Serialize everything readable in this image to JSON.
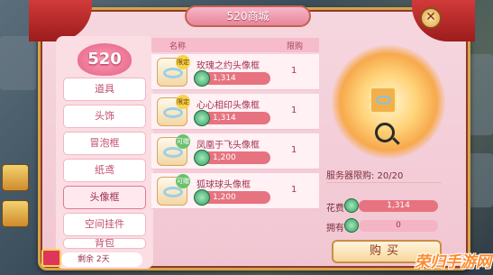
{
  "window": {
    "title": "520商城",
    "close_glyph": "✕"
  },
  "badge": "520",
  "categories": [
    {
      "label": "道具"
    },
    {
      "label": "头饰"
    },
    {
      "label": "冒泡框"
    },
    {
      "label": "纸鸢"
    },
    {
      "label": "头像框",
      "active": true
    },
    {
      "label": "空间挂件"
    },
    {
      "label": "背包"
    }
  ],
  "remaining": "剩余 2天",
  "table": {
    "col_name": "名称",
    "col_limit": "限购",
    "rows": [
      {
        "name": "玫瑰之约头像框",
        "price": "1,314",
        "limit": "1",
        "tag": "限定",
        "tag_color": "gold"
      },
      {
        "name": "心心相印头像框",
        "price": "1,314",
        "limit": "1",
        "tag": "限定",
        "tag_color": "gold"
      },
      {
        "name": "凤凰于飞头像框",
        "price": "1,200",
        "limit": "1",
        "tag": "可赠",
        "tag_color": "green"
      },
      {
        "name": "狐球球头像框",
        "price": "1,200",
        "limit": "1",
        "tag": "可赠",
        "tag_color": "green"
      }
    ]
  },
  "preview": {
    "server_limit": "服务器限购: 20/20",
    "cost_label": "花费",
    "cost_value": "1,314",
    "owned_label": "拥有",
    "owned_value": "0",
    "buy_label": "购买"
  },
  "watermark": "荣归手游网",
  "colors": {
    "accent": "#e6737f",
    "frame": "#d9a24a",
    "panel": "#f6d7df"
  },
  "icons": [
    "close-icon",
    "gift-icon",
    "magnifier-icon",
    "coin-icon"
  ]
}
